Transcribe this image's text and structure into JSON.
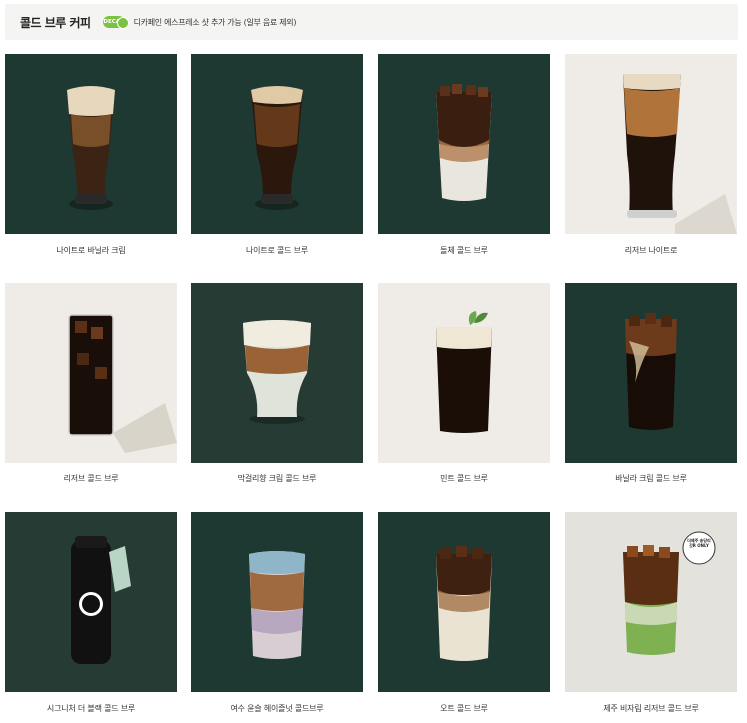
{
  "header": {
    "title": "콜드 브루 커피",
    "badge_label": "DECAF",
    "note": "디카페인 에스프레소 샷 추가 가능 (일부 음료 제외)"
  },
  "products": [
    {
      "name": "나이트로 바닐라 크림",
      "bg": "#1e3932"
    },
    {
      "name": "나이트로 콜드 브루",
      "bg": "#1e3932"
    },
    {
      "name": "돌체 콜드 브루",
      "bg": "#1e3932"
    },
    {
      "name": "리저브 나이트로",
      "bg": "#efece7"
    },
    {
      "name": "리저브 콜드 브루",
      "bg": "#efece7"
    },
    {
      "name": "막걸리향 크림 콜드 브루",
      "bg": "#263b34"
    },
    {
      "name": "민트 콜드 브루",
      "bg": "#efece7"
    },
    {
      "name": "바닐라 크림 콜드 브루",
      "bg": "#1e3932"
    },
    {
      "name": "시그니처 더 블랙 콜드 브루",
      "bg": "#263b34"
    },
    {
      "name": "여수 윤슬 헤이즐넛 콜드브루",
      "bg": "#1e3932"
    },
    {
      "name": "오트 콜드 브루",
      "bg": "#1e3932"
    },
    {
      "name": "제주 비자림 리저브 콜드 브루",
      "bg": "#e4e2dd"
    }
  ],
  "jeju_badge": "더제주 송당리갓R ONLY"
}
